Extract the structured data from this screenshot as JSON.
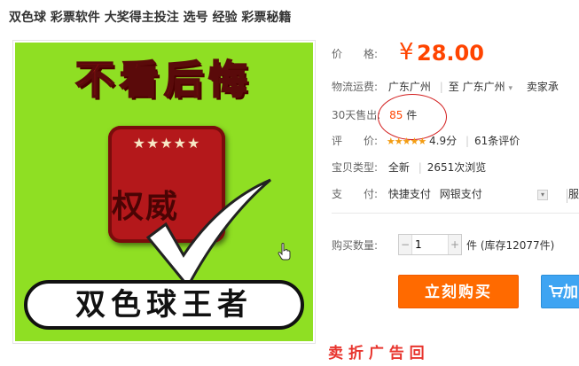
{
  "product": {
    "title": "双色球 彩票软件 大奖得主投注 选号 经验 彩票秘籍"
  },
  "image": {
    "headline": "不看后悔",
    "badge_stars": "★★★★★",
    "badge_text": "权威",
    "bottom_text": "双色球王者"
  },
  "details": {
    "price_label": "价　　格:",
    "price_symbol": "¥",
    "price_value": "28.00",
    "shipping_label": "物流运费:",
    "shipping_from": "广东广州",
    "shipping_sep": "|",
    "shipping_to_word": "至",
    "shipping_to": "广东广州",
    "shipping_dropdown": "▾",
    "shipping_seller": "卖家承",
    "sold_label": "30天售出:",
    "sold_count": "85",
    "sold_unit": "件",
    "rating_label": "评　　价:",
    "rating_stars": "★★★★★",
    "rating_score": "4.9分",
    "rating_sep": "|",
    "rating_count": "61条评价",
    "type_label": "宝贝类型:",
    "type_value": "全新",
    "type_sep": "|",
    "views": "2651次浏览",
    "pay_label": "支　　付:",
    "pay_quick": "快捷支付",
    "pay_bank": "网银支付",
    "pay_cut": "服",
    "qty_label": "购买数量:",
    "qty_dec": "−",
    "qty_value": "1",
    "qty_inc": "+",
    "qty_unit": "件 (库存12077件)",
    "buy_label": "立刻购买",
    "cart_label": "加",
    "bottom_cut": "卖  折  广  告  回"
  },
  "colors": {
    "accent": "#ff4400",
    "buy": "#ff6a00",
    "cart": "#3ea4f2",
    "image_bg": "#8fdf23"
  }
}
